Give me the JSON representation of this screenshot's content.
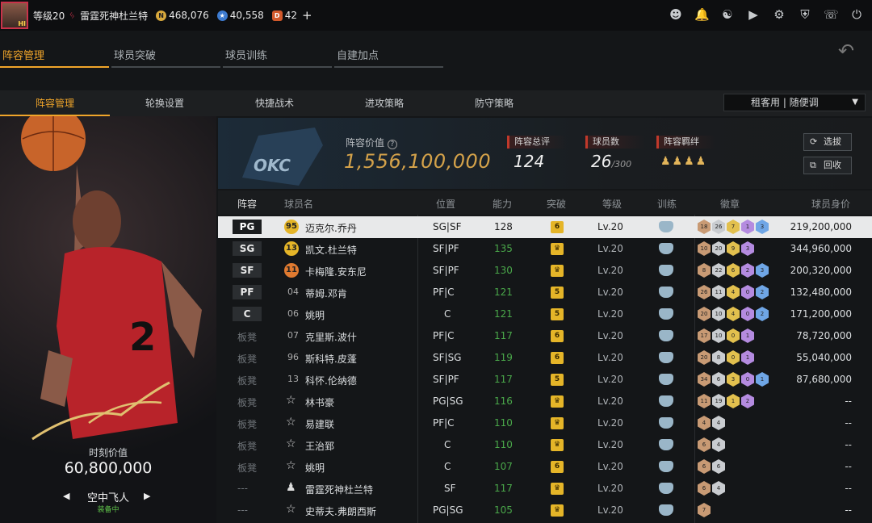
{
  "topbar": {
    "level": "等级20",
    "player_name": "雷霆死神杜兰特",
    "gold": "468,076",
    "stars": "40,558",
    "tickets": "42",
    "plus": "+",
    "icons": [
      "user-icon",
      "bell-icon",
      "friends-icon",
      "video-icon",
      "gear-icon",
      "shield-icon",
      "headset-icon",
      "power-icon"
    ]
  },
  "main_tabs": [
    "阵容管理",
    "球员突破",
    "球员训练",
    "自建加点"
  ],
  "sub_tabs": [
    "阵容管理",
    "轮换设置",
    "快捷战术",
    "进攻策略",
    "防守策略"
  ],
  "rent_select": "租客用 | 随便调",
  "left_card": {
    "moment_label": "时刻价值",
    "moment_value": "60,800,000",
    "card_name": "空中飞人",
    "status": "装备中"
  },
  "info": {
    "value_label": "阵容价值",
    "value": "1,556,100,000",
    "rating_label": "阵容总评",
    "rating": "124",
    "count_label": "球员数",
    "count": "26",
    "count_max": "/300",
    "synergy_label": "阵容羁绊",
    "btn_pick": "选拔",
    "btn_recycle": "回收"
  },
  "table_headers": {
    "lineup": "阵容",
    "name": "球员名",
    "position": "位置",
    "ability": "能力",
    "breakthrough": "突破",
    "level": "等级",
    "training": "训练",
    "badges": "徽章",
    "value": "球员身价"
  },
  "rows": [
    {
      "slot": "PG",
      "num": "95",
      "name": "迈克尔.乔丹",
      "position": "SG|SF",
      "ability": "128",
      "brk": "6",
      "level": "Lv.20",
      "badges": [
        "18",
        "26",
        "7",
        "1",
        "3"
      ],
      "price": "219,200,000",
      "sel": true,
      "icon": "gold"
    },
    {
      "slot": "SG",
      "num": "13",
      "name": "凯文.杜兰特",
      "position": "SF|PF",
      "ability": "135",
      "brk": "",
      "level": "Lv.20",
      "badges": [
        "10",
        "20",
        "9",
        "3"
      ],
      "price": "344,960,000",
      "icon": "gold"
    },
    {
      "slot": "SF",
      "num": "11",
      "name": "卡梅隆.安东尼",
      "position": "SF|PF",
      "ability": "130",
      "brk": "",
      "level": "Lv.20",
      "badges": [
        "8",
        "22",
        "6",
        "2",
        "3"
      ],
      "price": "200,320,000",
      "icon": "orange"
    },
    {
      "slot": "PF",
      "num": "04",
      "name": "蒂姆.邓肯",
      "position": "PF|C",
      "ability": "121",
      "brk": "5",
      "level": "Lv.20",
      "badges": [
        "26",
        "11",
        "4",
        "0",
        "2"
      ],
      "price": "132,480,000"
    },
    {
      "slot": "C",
      "num": "06",
      "name": "姚明",
      "position": "C",
      "ability": "121",
      "brk": "5",
      "level": "Lv.20",
      "badges": [
        "20",
        "10",
        "4",
        "0",
        "2"
      ],
      "price": "171,200,000"
    },
    {
      "slot": "板凳",
      "num": "07",
      "name": "克里斯.波什",
      "position": "PF|C",
      "ability": "117",
      "brk": "6",
      "level": "Lv.20",
      "badges": [
        "17",
        "10",
        "0",
        "1"
      ],
      "price": "78,720,000"
    },
    {
      "slot": "板凳",
      "num": "96",
      "name": "斯科特.皮蓬",
      "position": "SF|SG",
      "ability": "119",
      "brk": "6",
      "level": "Lv.20",
      "badges": [
        "20",
        "8",
        "0",
        "1"
      ],
      "price": "55,040,000"
    },
    {
      "slot": "板凳",
      "num": "13",
      "name": "科怀.伦纳德",
      "position": "SF|PF",
      "ability": "117",
      "brk": "5",
      "level": "Lv.20",
      "badges": [
        "34",
        "6",
        "3",
        "0",
        "1"
      ],
      "price": "87,680,000"
    },
    {
      "slot": "板凳",
      "num": "star",
      "name": "林书豪",
      "position": "PG|SG",
      "ability": "116",
      "brk": "",
      "level": "Lv.20",
      "badges": [
        "11",
        "19",
        "1",
        "2"
      ],
      "price": "--"
    },
    {
      "slot": "板凳",
      "num": "star",
      "name": "易建联",
      "position": "PF|C",
      "ability": "110",
      "brk": "",
      "level": "Lv.20",
      "badges": [
        "4",
        "4"
      ],
      "price": "--"
    },
    {
      "slot": "板凳",
      "num": "star",
      "name": "王治郅",
      "position": "C",
      "ability": "110",
      "brk": "",
      "level": "Lv.20",
      "badges": [
        "6",
        "4"
      ],
      "price": "--"
    },
    {
      "slot": "板凳",
      "num": "star",
      "name": "姚明",
      "position": "C",
      "ability": "107",
      "brk": "6",
      "level": "Lv.20",
      "badges": [
        "6",
        "6"
      ],
      "price": "--"
    },
    {
      "slot": "---",
      "num": "person",
      "name": "雷霆死神杜兰特",
      "position": "SF",
      "ability": "117",
      "brk": "",
      "level": "Lv.20",
      "badges": [
        "6",
        "4"
      ],
      "price": "--"
    },
    {
      "slot": "---",
      "num": "star",
      "name": "史蒂夫.弗朗西斯",
      "position": "PG|SG",
      "ability": "105",
      "brk": "",
      "level": "Lv.20",
      "badges": [
        "7"
      ],
      "price": "--"
    }
  ]
}
